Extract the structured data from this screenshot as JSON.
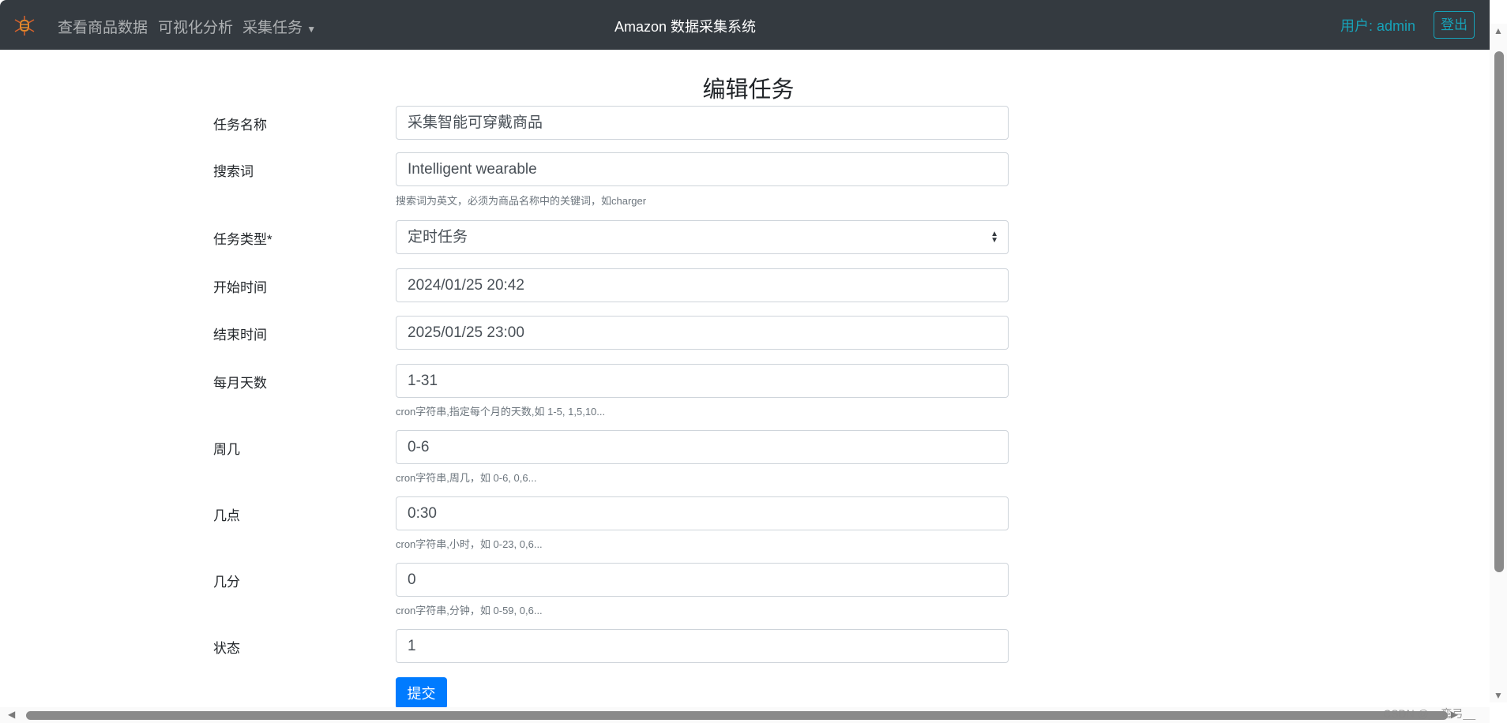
{
  "navbar": {
    "logo": "spider-database-logo",
    "links": [
      "查看商品数据",
      "可视化分析",
      "采集任务"
    ],
    "brand": "Amazon 数据采集系统",
    "user": "用户: admin",
    "logout": "登出",
    "accent": "#17a2b8"
  },
  "page": {
    "title": "编辑任务"
  },
  "form": {
    "name": {
      "label": "任务名称",
      "value": "采集智能可穿戴商品"
    },
    "keyword": {
      "label": "搜索词",
      "value": "Intelligent wearable",
      "help": "搜索词为英文，必须为商品名称中的关键词，如charger"
    },
    "type": {
      "label": "任务类型*",
      "value": "定时任务"
    },
    "start": {
      "label": "开始时间",
      "value": "2024/01/25 20:42"
    },
    "end": {
      "label": "结束时间",
      "value": "2025/01/25 23:00"
    },
    "days": {
      "label": "每月天数",
      "value": "1-31",
      "help": "cron字符串,指定每个月的天数,如 1-5, 1,5,10..."
    },
    "weekday": {
      "label": "周几",
      "value": "0-6",
      "help": "cron字符串,周几，如 0-6, 0,6..."
    },
    "hour": {
      "label": "几点",
      "value": "0:30",
      "help": "cron字符串,小时，如 0-23, 0,6..."
    },
    "minute": {
      "label": "几分",
      "value": "0",
      "help": "cron字符串,分钟，如 0-59, 0,6..."
    },
    "status": {
      "label": "状态",
      "value": "1"
    },
    "submit": "提交"
  },
  "watermark": "CSDN @__弯弓__"
}
